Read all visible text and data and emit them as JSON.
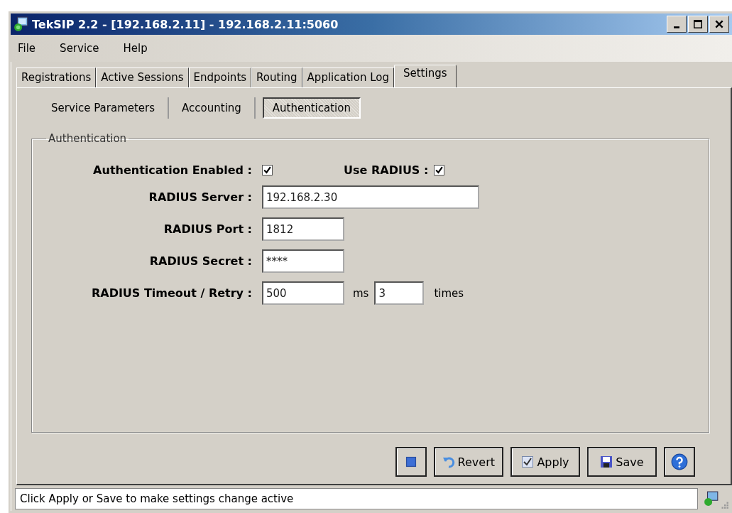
{
  "window": {
    "title": "TekSIP 2.2 - [192.168.2.11] - 192.168.2.11:5060"
  },
  "menu": [
    "File",
    "Service",
    "Help"
  ],
  "tabs": [
    {
      "label": "Registrations",
      "selected": false
    },
    {
      "label": "Active Sessions",
      "selected": false
    },
    {
      "label": "Endpoints",
      "selected": false
    },
    {
      "label": "Routing",
      "selected": false
    },
    {
      "label": "Application Log",
      "selected": false
    },
    {
      "label": "Settings",
      "selected": true
    }
  ],
  "subtabs": [
    {
      "label": "Service Parameters",
      "selected": false
    },
    {
      "label": "Accounting",
      "selected": false
    },
    {
      "label": "Authentication",
      "selected": true
    }
  ],
  "group": {
    "title": "Authentication",
    "rows": [
      {
        "kind": "checks",
        "items": [
          {
            "label": "Authentication Enabled :",
            "checked": true
          },
          {
            "label": "Use RADIUS :",
            "checked": true
          }
        ]
      },
      {
        "kind": "wide",
        "label": "RADIUS Server :",
        "value": "192.168.2.30"
      },
      {
        "kind": "field",
        "label": "RADIUS Port :",
        "value": "1812"
      },
      {
        "kind": "field",
        "label": "RADIUS Secret :",
        "value": "****"
      },
      {
        "kind": "pair",
        "label": "RADIUS Timeout / Retry :",
        "value": "500",
        "unit": "ms",
        "value2": "3",
        "unit2": "times"
      }
    ]
  },
  "buttons": [
    {
      "kind": "stop"
    },
    {
      "kind": "revert",
      "label": "Revert"
    },
    {
      "kind": "apply",
      "label": "Apply"
    },
    {
      "kind": "save",
      "label": "Save"
    },
    {
      "kind": "help"
    }
  ],
  "status_bar": {
    "text": "Click Apply or Save to make settings change active"
  }
}
